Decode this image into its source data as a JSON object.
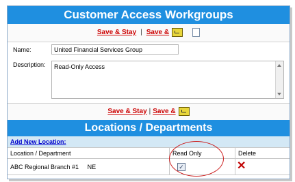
{
  "header": {
    "title": "Customer Access Workgroups"
  },
  "top_actions": {
    "save_stay": "Save & Stay",
    "separator": "|",
    "save_and": "Save &"
  },
  "form": {
    "name_label": "Name:",
    "name_value": "United Financial Services Group",
    "description_label": "Description:",
    "description_value": "Read-Only Access"
  },
  "mid_actions": {
    "save_stay": "Save & Stay",
    "separator": "|",
    "save_and": "Save &"
  },
  "locations": {
    "title": "Locations / Departments",
    "add_link": "Add New Location:",
    "columns": [
      "Location / Department",
      "Read Only",
      "Delete"
    ],
    "rows": [
      {
        "location": "ABC Regional Branch #1",
        "state": "NE",
        "read_only": true
      }
    ]
  },
  "icons": {
    "folder": "folder-up-icon",
    "document": "new-document-icon",
    "delete": "delete-x-icon",
    "highlight": "red-circle-annotation"
  },
  "colors": {
    "header_blue": "#1f8fe0",
    "link_red": "#cc0000",
    "add_row_bg": "#d3e8f5"
  }
}
